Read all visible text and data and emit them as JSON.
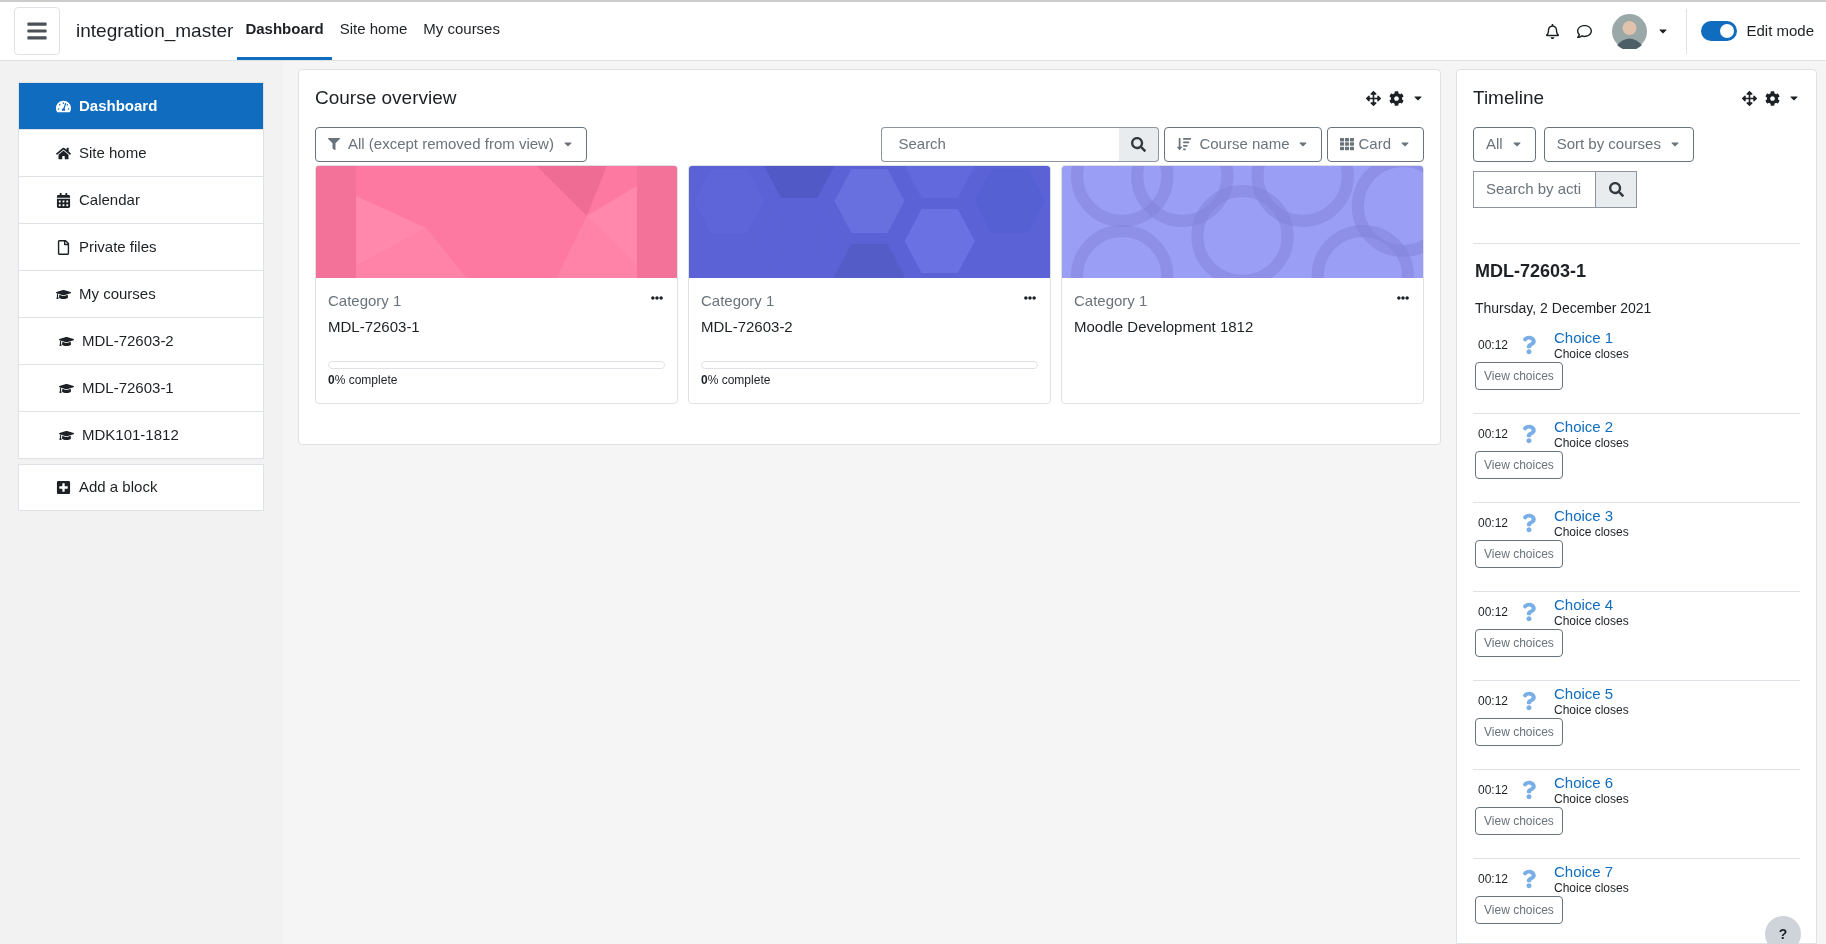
{
  "header": {
    "site_name": "integration_master",
    "nav": [
      {
        "label": "Dashboard",
        "selected": true
      },
      {
        "label": "Site home",
        "selected": false
      },
      {
        "label": "My courses",
        "selected": false
      }
    ],
    "edit_mode": {
      "label": "Edit mode",
      "on": true
    }
  },
  "sidebar": {
    "items": [
      {
        "label": "Dashboard",
        "selected": true
      },
      {
        "label": "Site home",
        "selected": false
      },
      {
        "label": "Calendar",
        "selected": false
      },
      {
        "label": "Private files",
        "selected": false
      },
      {
        "label": "My courses",
        "selected": false,
        "children": [
          {
            "label": "MDL-72603-2",
            "selected": false
          },
          {
            "label": "MDL-72603-1",
            "selected": false
          },
          {
            "label": "MDK101-1812",
            "selected": false
          }
        ]
      }
    ],
    "add_block": "Add a block"
  },
  "course_overview": {
    "title": "Course overview",
    "filter": "All (except removed from view)",
    "search": {
      "placeholder": "Search"
    },
    "sort": "Course name",
    "view": "Card",
    "courses": [
      {
        "category": "Category 1",
        "name": "MDL-72603-1",
        "progress": {
          "level": 0,
          "text": "**0**% complete"
        }
      },
      {
        "category": "Category 1",
        "name": "MDL-72603-2",
        "progress": {
          "level": 0,
          "text": "**0**% complete"
        }
      },
      {
        "category": "Category 1",
        "name": "Moodle Development 1812"
      }
    ]
  },
  "timeline": {
    "title": "Timeline",
    "filter": "All",
    "sort": "Sort by courses",
    "search": {
      "placeholder": "Search by acti"
    },
    "course": "MDL-72603-1",
    "date": "Thursday, 2 December 2021",
    "events": [
      {
        "time": "00:12",
        "name": "Choice 1",
        "subtitle": "Choice closes",
        "action": "View choices"
      },
      {
        "time": "00:12",
        "name": "Choice 2",
        "subtitle": "Choice closes",
        "action": "View choices"
      },
      {
        "time": "00:12",
        "name": "Choice 3",
        "subtitle": "Choice closes",
        "action": "View choices"
      },
      {
        "time": "00:12",
        "name": "Choice 4",
        "subtitle": "Choice closes",
        "action": "View choices"
      },
      {
        "time": "00:12",
        "name": "Choice 5",
        "subtitle": "Choice closes",
        "action": "View choices"
      },
      {
        "time": "00:12",
        "name": "Choice 6",
        "subtitle": "Choice closes",
        "action": "View choices"
      },
      {
        "time": "00:12",
        "name": "Choice 7",
        "subtitle": "Choice closes",
        "action": "View choices"
      }
    ]
  },
  "help_button": "?"
}
